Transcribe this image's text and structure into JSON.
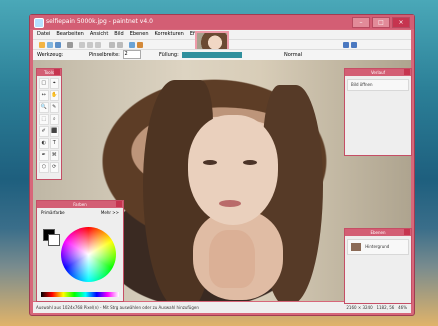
{
  "window": {
    "title": "selfiepain 5000k.jpg - paintnet v4.0"
  },
  "menu": [
    "Datei",
    "Bearbeiten",
    "Ansicht",
    "Bild",
    "Ebenen",
    "Korrekturen",
    "Effekte"
  ],
  "toolbar": {
    "tool_label": "Werkzeug:",
    "size_label": "Pinselbreite:",
    "size_value": "2",
    "fill_label": "Füllung:",
    "blend_label": "Normal"
  },
  "panels": {
    "tools": {
      "title": "Tools",
      "items": [
        "□",
        "⌖",
        "↔",
        "✋",
        "🔍",
        "✎",
        "⬚",
        "⌕",
        "✐",
        "⬛",
        "◐",
        "T",
        "✒",
        "⌘",
        "⬡",
        "⟳"
      ]
    },
    "colors": {
      "title": "Farben",
      "primary_label": "Primärfarbe",
      "more_label": "Mehr >>"
    },
    "history": {
      "title": "Verlauf",
      "items": [
        "Bild öffnen"
      ]
    },
    "layers": {
      "title": "Ebenen",
      "items": [
        "Hintergrund"
      ]
    }
  },
  "statusbar": {
    "text": "Auswahl aus 1024x768 Pixel(n) - Mit Strg auswählen oder zu Auswahl hinzufügen",
    "dims": "2160 × 3240",
    "pos": "1182, 56",
    "zoom": "46%"
  }
}
